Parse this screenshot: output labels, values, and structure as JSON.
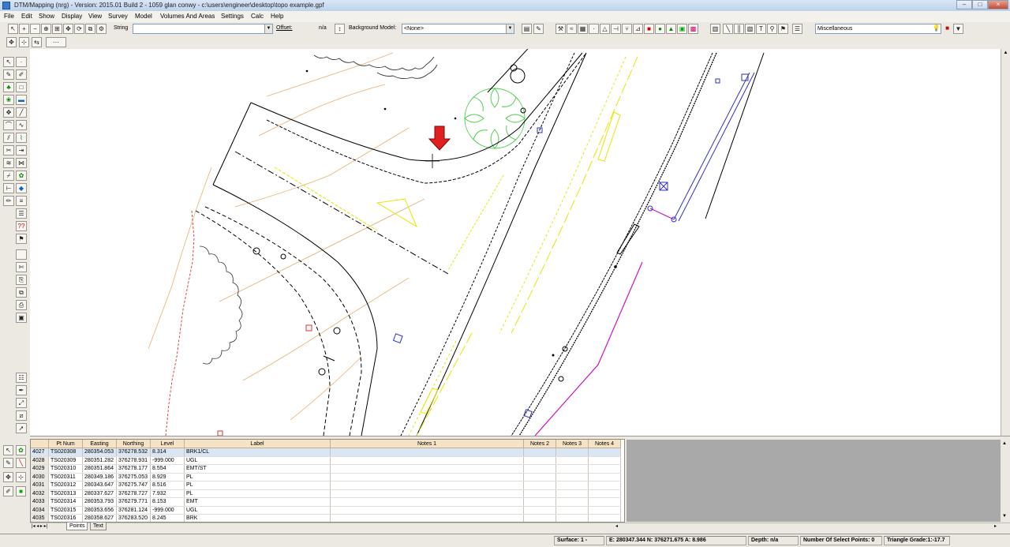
{
  "window": {
    "title": "DTM/Mapping (nrg) - Version: 2015.01 Build 2 - 1059 glan conwy - c:\\users\\engineer\\desktop\\topo example.gpf",
    "min_label": "–",
    "max_label": "□",
    "close_label": "×"
  },
  "menu": [
    "File",
    "Edit",
    "Show",
    "Display",
    "View",
    "Survey",
    "Model",
    "Volumes And Areas",
    "Settings",
    "Calc",
    "Help"
  ],
  "toolbar": {
    "string_label": "String",
    "string_value": "",
    "offset_label": "Offset:",
    "offset_value": "n/a",
    "background_model_label": "Background Model:",
    "background_model_value": "<None>",
    "layer_value": "Miscellaneous"
  },
  "points_table": {
    "columns": [
      "",
      "Pt Num",
      "Easting",
      "Northing",
      "Level",
      "Label",
      "Notes 1",
      "Notes 2",
      "Notes 3",
      "Notes 4"
    ],
    "rows": [
      [
        "4027",
        "TS020308",
        "280354.053",
        "376278.532",
        "8.314",
        "BRK1/CL"
      ],
      [
        "4028",
        "TS020309",
        "280351.282",
        "376278.931",
        "-999.000",
        "UGL"
      ],
      [
        "4029",
        "TS020310",
        "280351.864",
        "376278.177",
        "8.554",
        "EMT/ST"
      ],
      [
        "4030",
        "TS020311",
        "280349.186",
        "376275.053",
        "8.929",
        "PL"
      ],
      [
        "4031",
        "TS020312",
        "280343.647",
        "376275.747",
        "8.516",
        "PL"
      ],
      [
        "4032",
        "TS020313",
        "280337.627",
        "376278.727",
        "7.932",
        "PL"
      ],
      [
        "4033",
        "TS020314",
        "280353.793",
        "376279.771",
        "8.153",
        "EMT"
      ],
      [
        "4034",
        "TS020315",
        "280353.656",
        "376281.124",
        "-999.000",
        "UGL"
      ],
      [
        "4035",
        "TS020316",
        "280358.627",
        "376283.520",
        "8.245",
        "BRK"
      ]
    ],
    "selected_row": 0
  },
  "tabs": [
    "Points",
    "Text"
  ],
  "status": {
    "surface": "Surface: 1 -",
    "coords": "E: 280347.344   N: 376271.675   A: 8.986",
    "depth": "Depth: n/a",
    "select_points": "Number Of Select Points: 0",
    "triangle_grade": "Triangle Grade:1:-17.7"
  },
  "colors": {
    "survey_line": "#000000",
    "kerb_yellow": "#e6e600",
    "boundary_magenta": "#d010c8",
    "tree_green": "#44cc44",
    "hedge_red": "#e03030",
    "contour_orange": "#e8b070",
    "marker_blue": "#3030c0",
    "cursor_arrow": "#e02020"
  },
  "icons": {
    "cursor": "red-down-arrow-icon"
  }
}
